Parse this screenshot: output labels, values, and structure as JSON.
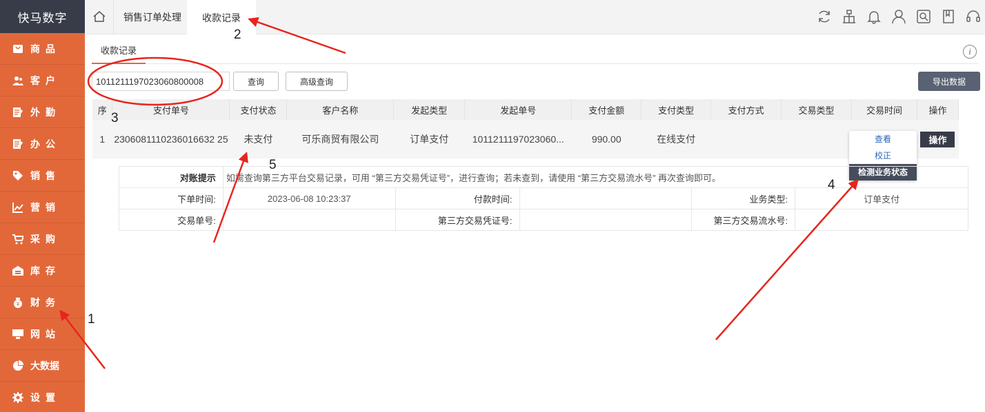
{
  "app": {
    "logo": "快马数字"
  },
  "sidebar": {
    "items": [
      {
        "label": "商品",
        "icon": "bag-icon"
      },
      {
        "label": "客户",
        "icon": "users-icon"
      },
      {
        "label": "外勤",
        "icon": "ledger-icon"
      },
      {
        "label": "办公",
        "icon": "ledger-icon"
      },
      {
        "label": "销售",
        "icon": "tag-icon"
      },
      {
        "label": "营销",
        "icon": "chart-icon"
      },
      {
        "label": "采购",
        "icon": "cart-icon"
      },
      {
        "label": "库存",
        "icon": "warehouse-icon"
      },
      {
        "label": "财务",
        "icon": "money-bag-icon"
      },
      {
        "label": "网站",
        "icon": "monitor-icon"
      },
      {
        "label": "大数据",
        "icon": "pie-icon"
      },
      {
        "label": "设置",
        "icon": "gear-icon"
      }
    ]
  },
  "topbar": {
    "tabs": [
      {
        "label": "销售订单处理"
      },
      {
        "label": "收款记录"
      }
    ],
    "icons": [
      "refresh-icon",
      "org-icon",
      "bell-icon",
      "user-icon",
      "search-box-icon",
      "book-icon",
      "headset-icon"
    ]
  },
  "page": {
    "subtab": "收款记录",
    "info_icon": "i",
    "search": {
      "value": "1011211197023060800008"
    },
    "buttons": {
      "query": "查询",
      "advanced": "高级查询",
      "export": "导出数据"
    }
  },
  "table": {
    "headers": [
      "序",
      "支付单号",
      "支付状态",
      "客户名称",
      "发起类型",
      "发起单号",
      "支付金额",
      "支付类型",
      "支付方式",
      "交易类型",
      "交易时间",
      "操作"
    ],
    "rows": [
      {
        "seq": "1",
        "pay_no": "2306081110236016632 25",
        "status": "未支付",
        "customer": "可乐商贸有限公司",
        "origin_type": "订单支付",
        "origin_no": "1011211197023060...",
        "amount": "990.00",
        "pay_type": "在线支付",
        "pay_method": "",
        "trade_type": "",
        "trade_time": "",
        "op": "操作"
      }
    ]
  },
  "menu": {
    "items": [
      "查看",
      "校正",
      "检测业务状态"
    ]
  },
  "detail": {
    "tip_label": "对账提示",
    "tip_text": "如需查询第三方平台交易记录，可用 “第三方交易凭证号”，进行查询；若未查到，请使用 “第三方交易流水号” 再次查询即可。",
    "order_time_label": "下单时间:",
    "order_time": "2023-06-08 10:23:37",
    "pay_time_label": "付款时间:",
    "pay_time": "",
    "biz_type_label": "业务类型:",
    "biz_type": "订单支付",
    "trade_no_label": "交易单号:",
    "trade_no": "",
    "voucher_label": "第三方交易凭证号:",
    "voucher": "",
    "serial_label": "第三方交易流水号:",
    "serial": ""
  },
  "annotations": {
    "n1": "1",
    "n2": "2",
    "n3": "3",
    "n4": "4",
    "n5": "5",
    "color": "#e8251d"
  }
}
